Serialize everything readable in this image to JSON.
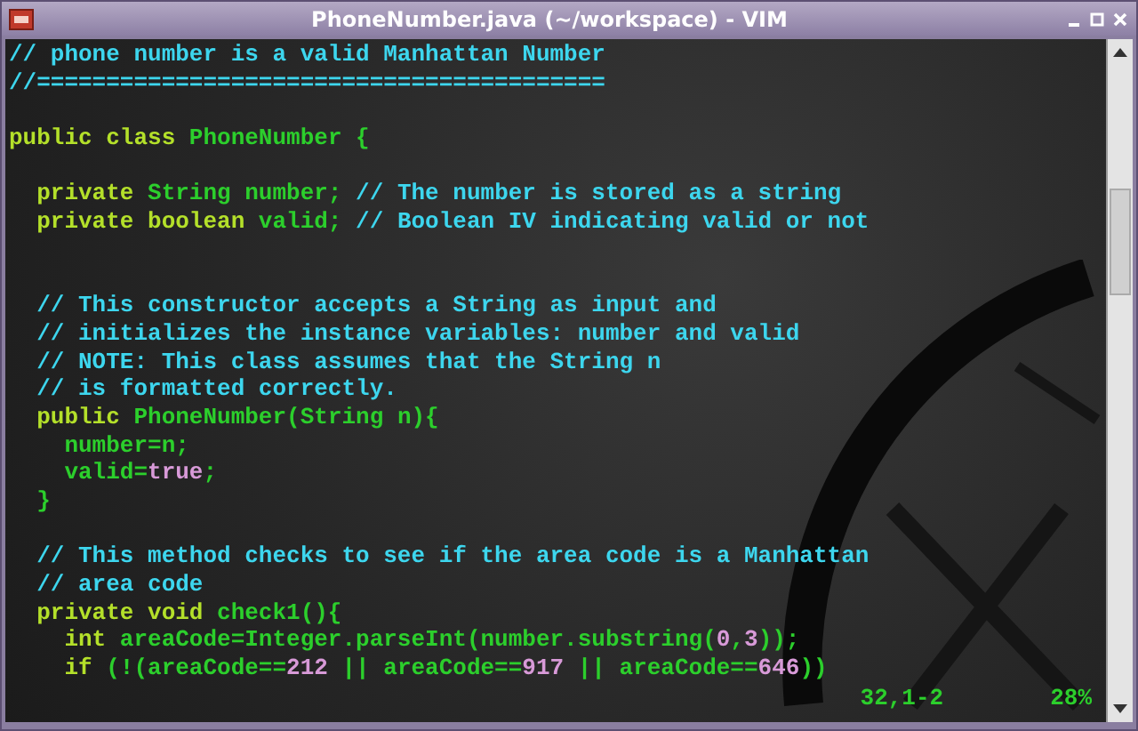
{
  "window": {
    "title": "PhoneNumber.java (~/workspace) - VIM"
  },
  "editor": {
    "lines": [
      {
        "kind": "code",
        "tokens": [
          {
            "kind": "comment",
            "text": "// phone number is a valid Manhattan Number"
          }
        ]
      },
      {
        "kind": "code",
        "tokens": [
          {
            "kind": "comment",
            "text": "//========================================="
          }
        ]
      },
      {
        "kind": "blank"
      },
      {
        "kind": "code",
        "tokens": [
          {
            "kind": "keyword",
            "text": "public class"
          },
          {
            "kind": "plain",
            "text": " PhoneNumber {"
          }
        ]
      },
      {
        "kind": "blank"
      },
      {
        "kind": "code",
        "tokens": [
          {
            "kind": "keyword",
            "text": "  private"
          },
          {
            "kind": "plain",
            "text": " String number;"
          },
          {
            "kind": "comment",
            "text": " // The number is stored as a string"
          }
        ]
      },
      {
        "kind": "code",
        "tokens": [
          {
            "kind": "keyword",
            "text": "  private boolean"
          },
          {
            "kind": "plain",
            "text": " valid;"
          },
          {
            "kind": "comment",
            "text": " // Boolean IV indicating valid or not"
          }
        ]
      },
      {
        "kind": "blank"
      },
      {
        "kind": "blank"
      },
      {
        "kind": "code",
        "tokens": [
          {
            "kind": "comment",
            "text": "  // This constructor accepts a String as input and"
          }
        ]
      },
      {
        "kind": "code",
        "tokens": [
          {
            "kind": "comment",
            "text": "  // initializes the instance variables: number and valid"
          }
        ]
      },
      {
        "kind": "code",
        "tokens": [
          {
            "kind": "comment",
            "text": "  // NOTE: This class assumes that the String n"
          }
        ]
      },
      {
        "kind": "code",
        "tokens": [
          {
            "kind": "comment",
            "text": "  // is formatted correctly."
          }
        ]
      },
      {
        "kind": "code",
        "tokens": [
          {
            "kind": "keyword",
            "text": "  public"
          },
          {
            "kind": "plain",
            "text": " PhoneNumber(String n){"
          }
        ]
      },
      {
        "kind": "code",
        "tokens": [
          {
            "kind": "plain",
            "text": "    number=n;"
          }
        ]
      },
      {
        "kind": "code",
        "tokens": [
          {
            "kind": "plain",
            "text": "    valid="
          },
          {
            "kind": "literal",
            "text": "true"
          },
          {
            "kind": "plain",
            "text": ";"
          }
        ]
      },
      {
        "kind": "code",
        "tokens": [
          {
            "kind": "plain",
            "text": "  }"
          }
        ]
      },
      {
        "kind": "blank"
      },
      {
        "kind": "code",
        "tokens": [
          {
            "kind": "comment",
            "text": "  // This method checks to see if the area code is a Manhattan"
          }
        ]
      },
      {
        "kind": "code",
        "tokens": [
          {
            "kind": "comment",
            "text": "  // area code"
          }
        ]
      },
      {
        "kind": "code",
        "tokens": [
          {
            "kind": "keyword",
            "text": "  private void"
          },
          {
            "kind": "plain",
            "text": " check1(){"
          }
        ]
      },
      {
        "kind": "code",
        "tokens": [
          {
            "kind": "keyword",
            "text": "    int"
          },
          {
            "kind": "plain",
            "text": " areaCode=Integer.parseInt(number.substring("
          },
          {
            "kind": "literal",
            "text": "0"
          },
          {
            "kind": "plain",
            "text": ","
          },
          {
            "kind": "literal",
            "text": "3"
          },
          {
            "kind": "plain",
            "text": "));"
          }
        ]
      },
      {
        "kind": "code",
        "tokens": [
          {
            "kind": "keyword",
            "text": "    if"
          },
          {
            "kind": "plain",
            "text": " (!(areaCode=="
          },
          {
            "kind": "literal",
            "text": "212"
          },
          {
            "kind": "plain",
            "text": " || areaCode=="
          },
          {
            "kind": "literal",
            "text": "917"
          },
          {
            "kind": "plain",
            "text": " || areaCode=="
          },
          {
            "kind": "literal",
            "text": "646"
          },
          {
            "kind": "plain",
            "text": "))"
          }
        ]
      }
    ],
    "status": {
      "position": "32,1-2",
      "percent": "28%"
    }
  }
}
